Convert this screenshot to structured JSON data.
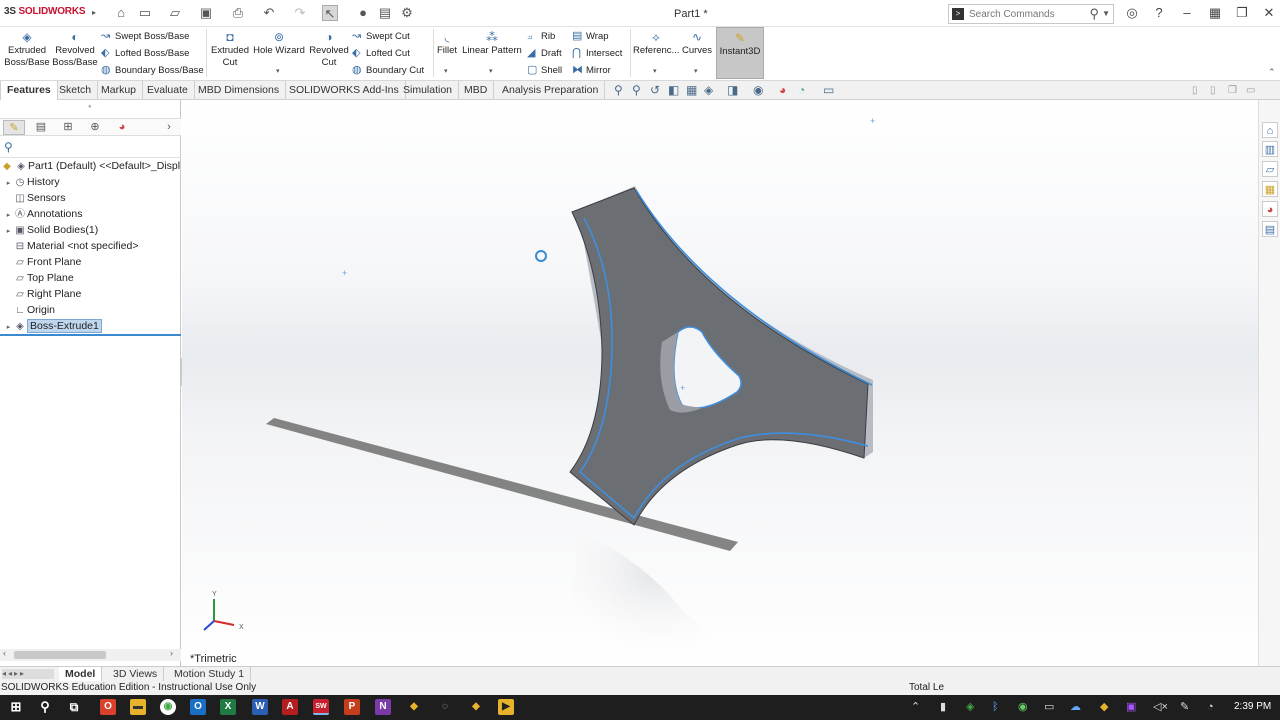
{
  "app": {
    "logo_brand": "SOLIDWORKS",
    "logo_prefix": "3S",
    "doc_title": "Part1 *"
  },
  "search": {
    "placeholder": "Search Commands"
  },
  "ribbon": {
    "extruded_boss": "Extruded Boss/Base",
    "revolved_boss": "Revolved Boss/Base",
    "swept_boss": "Swept Boss/Base",
    "lofted_boss": "Lofted Boss/Base",
    "boundary_boss": "Boundary Boss/Base",
    "extruded_cut": "Extruded Cut",
    "hole_wizard": "Hole Wizard",
    "revolved_cut": "Revolved Cut",
    "swept_cut": "Swept Cut",
    "lofted_cut": "Lofted Cut",
    "boundary_cut": "Boundary Cut",
    "fillet": "Fillet",
    "linear_pattern": "Linear Pattern",
    "rib": "Rib",
    "draft": "Draft",
    "shell": "Shell",
    "wrap": "Wrap",
    "intersect": "Intersect",
    "mirror": "Mirror",
    "reference": "Referenc...",
    "curves": "Curves",
    "instant3d": "Instant3D"
  },
  "tabs": [
    "Features",
    "Sketch",
    "Markup",
    "Evaluate",
    "MBD Dimensions",
    "SOLIDWORKS Add-Ins",
    "Simulation",
    "MBD",
    "Analysis Preparation"
  ],
  "tree": {
    "root": "Part1 (Default) <<Default>_Displ",
    "items": [
      "History",
      "Sensors",
      "Annotations",
      "Solid Bodies(1)",
      "Material <not specified>",
      "Front Plane",
      "Top Plane",
      "Right Plane",
      "Origin",
      "Boss-Extrude1"
    ]
  },
  "viewport": {
    "view_label": "*Trimetric",
    "axis_x": "X",
    "axis_y": "Y"
  },
  "bottom_tabs": [
    "Model",
    "3D Views",
    "Motion Study 1"
  ],
  "status": {
    "left": "SOLIDWORKS Education Edition - Instructional Use Only",
    "right": "Total Le"
  },
  "taskbar": {
    "time": "2:39 PM"
  }
}
